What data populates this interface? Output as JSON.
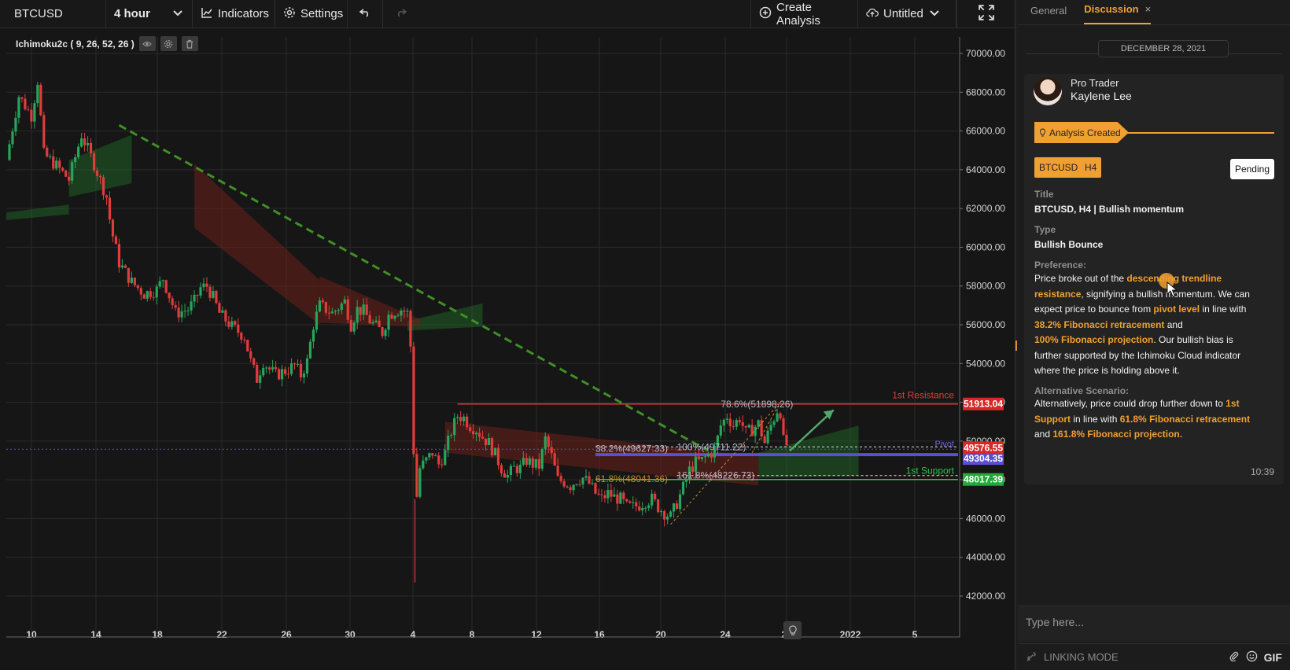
{
  "toolbar": {
    "symbol": "BTCUSD",
    "timeframe": "4 hour",
    "indicators_label": "Indicators",
    "settings_label": "Settings",
    "create_label": "Create Analysis",
    "layout_name": "Untitled"
  },
  "indicator": {
    "label": "Ichimoku2c ( 9, 26, 52, 26 )"
  },
  "chart_data": {
    "type": "candlestick",
    "symbol": "BTCUSD",
    "timeframe": "4 hour",
    "y_ticks": [
      "70000.00",
      "68000.00",
      "66000.00",
      "64000.00",
      "62000.00",
      "60000.00",
      "58000.00",
      "56000.00",
      "54000.00",
      "52000.00",
      "50000.00",
      "48000.00",
      "46000.00",
      "44000.00",
      "42000.00"
    ],
    "x_ticks": [
      "10",
      "14",
      "18",
      "22",
      "26",
      "30",
      "4",
      "8",
      "12",
      "16",
      "20",
      "24",
      "28",
      "2022",
      "5"
    ],
    "ylim": [
      41800,
      70800
    ],
    "grid": true,
    "close_path": [
      [
        0,
        64500
      ],
      [
        2,
        67800
      ],
      [
        4,
        66800
      ],
      [
        5,
        68600
      ],
      [
        6,
        64800
      ],
      [
        8,
        64200
      ],
      [
        10,
        63500
      ],
      [
        12,
        65800
      ],
      [
        14,
        64300
      ],
      [
        16,
        62600
      ],
      [
        16.7,
        61000
      ],
      [
        18,
        59200
      ],
      [
        20,
        58200
      ],
      [
        22,
        57600
      ],
      [
        24,
        57800
      ],
      [
        25,
        58400
      ],
      [
        27,
        56600
      ],
      [
        29,
        56800
      ],
      [
        30,
        57200
      ],
      [
        31,
        57900
      ],
      [
        32,
        58000
      ],
      [
        33,
        57400
      ],
      [
        34,
        56600
      ],
      [
        36,
        55900
      ],
      [
        38,
        55400
      ],
      [
        39,
        54100
      ],
      [
        40,
        53200
      ],
      [
        41,
        54100
      ],
      [
        42,
        53700
      ],
      [
        43,
        53400
      ],
      [
        45,
        53700
      ],
      [
        46,
        53900
      ],
      [
        47,
        53400
      ],
      [
        48,
        54100
      ],
      [
        49,
        56000
      ],
      [
        50,
        57000
      ],
      [
        52,
        56600
      ],
      [
        54,
        57200
      ],
      [
        55,
        56000
      ],
      [
        56,
        56800
      ],
      [
        57,
        56700
      ],
      [
        58,
        56200
      ],
      [
        59,
        55900
      ],
      [
        60,
        55600
      ],
      [
        61,
        56500
      ],
      [
        62,
        56700
      ],
      [
        63,
        56800
      ],
      [
        64,
        56600
      ],
      [
        64.5,
        54900
      ],
      [
        64.8,
        53900
      ],
      [
        65,
        49500
      ],
      [
        65.3,
        47400
      ],
      [
        65.7,
        46900
      ],
      [
        66,
        48600
      ],
      [
        67,
        49000
      ],
      [
        68,
        49400
      ],
      [
        69,
        48800
      ],
      [
        70,
        49400
      ],
      [
        71,
        50500
      ],
      [
        72,
        51300
      ],
      [
        73,
        51200
      ],
      [
        74,
        50800
      ],
      [
        75,
        50600
      ],
      [
        76,
        50200
      ],
      [
        77,
        49900
      ],
      [
        78,
        49300
      ],
      [
        79,
        48600
      ],
      [
        80,
        48200
      ],
      [
        81,
        48600
      ],
      [
        82,
        48600
      ],
      [
        83,
        49000
      ],
      [
        84,
        48800
      ],
      [
        85,
        48700
      ],
      [
        86,
        50100
      ],
      [
        87,
        49200
      ],
      [
        88,
        48000
      ],
      [
        89,
        47900
      ],
      [
        90,
        47700
      ],
      [
        91,
        48000
      ],
      [
        92,
        48100
      ],
      [
        93,
        47800
      ],
      [
        94,
        47300
      ],
      [
        95,
        47000
      ],
      [
        96,
        47300
      ],
      [
        97,
        47100
      ],
      [
        98,
        47000
      ],
      [
        99,
        46600
      ],
      [
        100,
        46600
      ],
      [
        101,
        46700
      ],
      [
        102,
        46900
      ],
      [
        103,
        47000
      ],
      [
        104,
        46600
      ],
      [
        105,
        46300
      ],
      [
        106,
        46100
      ],
      [
        107,
        46800
      ],
      [
        108,
        47600
      ],
      [
        109,
        48500
      ],
      [
        110,
        48900
      ],
      [
        111,
        49000
      ],
      [
        112,
        49300
      ],
      [
        113,
        49500
      ],
      [
        114,
        50800
      ],
      [
        115,
        51300
      ],
      [
        116,
        50800
      ],
      [
        117,
        51200
      ],
      [
        118,
        50400
      ],
      [
        119,
        50600
      ],
      [
        120,
        50900
      ],
      [
        121,
        49900
      ],
      [
        122,
        50800
      ],
      [
        123,
        51600
      ],
      [
        123.5,
        51500
      ],
      [
        124,
        50000
      ],
      [
        124.5,
        49800
      ]
    ],
    "ichimoku_cloud": {
      "green_segments": [
        {
          "x": [
            0,
            10
          ],
          "top": [
            61800,
            62200
          ],
          "bottom": [
            61400,
            61700
          ]
        },
        {
          "x": [
            10,
            20
          ],
          "top": [
            64500,
            65800
          ],
          "bottom": [
            62600,
            63300
          ]
        },
        {
          "x": [
            64,
            76
          ],
          "top": [
            56200,
            57100
          ],
          "bottom": [
            55700,
            55900
          ]
        },
        {
          "x": [
            120,
            136
          ],
          "top": [
            49400,
            50800
          ],
          "bottom": [
            48100,
            48200
          ]
        }
      ],
      "red_segments": [
        {
          "x": [
            30,
            50
          ],
          "top": [
            64300,
            58300
          ],
          "bottom": [
            61000,
            56000
          ]
        },
        {
          "x": [
            50,
            66
          ],
          "top": [
            58500,
            56300
          ],
          "bottom": [
            56100,
            55900
          ]
        },
        {
          "x": [
            70,
            120
          ],
          "top": [
            51000,
            49200
          ],
          "bottom": [
            49400,
            47700
          ]
        }
      ]
    },
    "trendline": {
      "from": [
        18,
        66300
      ],
      "to": [
        112,
        49500
      ]
    },
    "levels": [
      {
        "name": "1st Resistance",
        "value": "51913.04",
        "color": "#e03c3c"
      },
      {
        "name": "Pivot",
        "value": "49576.55",
        "color": "#7b6ee8"
      },
      {
        "name": "1st Support",
        "value": "48017.39",
        "color": "#2ec54a"
      }
    ],
    "current_price": "49576.55",
    "pivot_label_value": "49304.35",
    "fib_labels": [
      {
        "text": "78.6%(51898.26)",
        "x": 114,
        "y": 51900
      },
      {
        "text": "38.2%(49627.33)",
        "x": 94,
        "y": 49600
      },
      {
        "text": "100%(49711.22)",
        "x": 107,
        "y": 49700
      },
      {
        "text": "61.8%(48041.36)",
        "x": 94,
        "y": 48040
      },
      {
        "text": "161.8%(48226.73)",
        "x": 107,
        "y": 48220
      }
    ],
    "projection_arrow": {
      "from": [
        125,
        49500
      ],
      "to": [
        132,
        51600
      ]
    }
  },
  "panel": {
    "tab_general": "General",
    "tab_discussion": "Discussion",
    "close_glyph": "×",
    "date": "DECEMBER 28, 2021",
    "author_role": "Pro Trader",
    "author_name": "Kaylene Lee",
    "created_label": "Analysis Created",
    "symbol_badge": "BTCUSD",
    "tf_badge": "H4",
    "status": "Pending",
    "title_label": "Title",
    "title_value": "BTCUSD, H4 | Bullish momentum",
    "type_label": "Type",
    "type_value": "Bullish Bounce",
    "preference_label": "Preference:",
    "preference": {
      "p1": "Price broke out of the ",
      "h1": "descending trendline resistance",
      "p2": ", signifying a bullish momentum. We can expect price to bounce from ",
      "h2": "pivot level",
      "p3": " in line with ",
      "h3": "38.2% Fibonacci retracement",
      "p4": " and ",
      "h4": "100% Fibonacci projection",
      "p5": ". Our bullish bias is further supported by the Ichimoku Cloud indicator where the price is holding above it."
    },
    "alt_label": "Alternative Scenario:",
    "alt": {
      "p1": "Alternatively, price could drop further down to ",
      "h1": "1st Support",
      "p2": " in line with ",
      "h2": "61.8% Fibonacci retracement",
      "p3": " and ",
      "h3": "161.8% Fibonacci projection."
    },
    "time": "10:39",
    "composer_placeholder": "Type here...",
    "linking_mode": "LINKING MODE",
    "gif_label": "GIF"
  },
  "colors": {
    "accent": "#f0a030",
    "up": "#26a65b",
    "down": "#e03c3c",
    "background": "#161616"
  }
}
